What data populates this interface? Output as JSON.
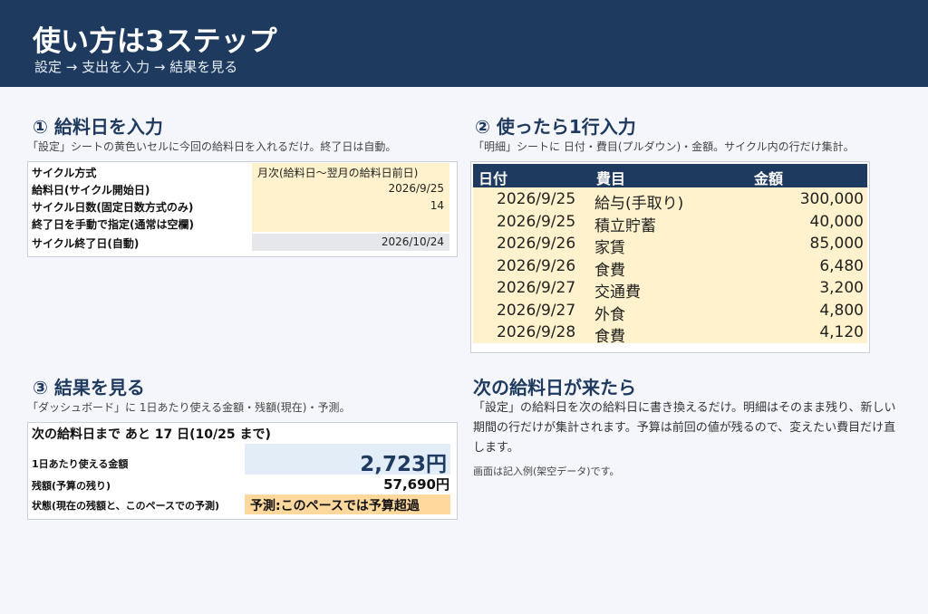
{
  "header": {
    "title": "使い方は3ステップ",
    "subtitle": "設定 → 支出を入力 → 結果を見る"
  },
  "step1": {
    "title": "① 給料日を入力",
    "desc": "「設定」シートの黄色いセルに今回の給料日を入れるだけ。終了日は自動。",
    "rows": [
      {
        "label": "サイクル方式",
        "value": "月次(給料日～翌月の給料日前日)"
      },
      {
        "label": "給料日(サイクル開始日)",
        "value": "2026/9/25"
      },
      {
        "label": "サイクル日数(固定日数方式のみ)",
        "value": "14"
      },
      {
        "label": "終了日を手動で指定(通常は空欄)",
        "value": ""
      },
      {
        "label": "サイクル終了日(自動)",
        "value": "2026/10/24"
      }
    ]
  },
  "step2": {
    "title": "② 使ったら1行入力",
    "desc": "「明細」シートに 日付・費目(プルダウン)・金額。サイクル内の行だけ集計。",
    "headers": {
      "date": "日付",
      "category": "費目",
      "amount": "金額"
    },
    "rows": [
      {
        "date": "2026/9/25",
        "category": "給与(手取り)",
        "amount": "300,000"
      },
      {
        "date": "2026/9/25",
        "category": "積立貯蓄",
        "amount": "40,000"
      },
      {
        "date": "2026/9/26",
        "category": "家賃",
        "amount": "85,000"
      },
      {
        "date": "2026/9/26",
        "category": "食費",
        "amount": "6,480"
      },
      {
        "date": "2026/9/27",
        "category": "交通費",
        "amount": "3,200"
      },
      {
        "date": "2026/9/27",
        "category": "外食",
        "amount": "4,800"
      },
      {
        "date": "2026/9/28",
        "category": "食費",
        "amount": "4,120"
      }
    ]
  },
  "step3": {
    "title": "③ 結果を見る",
    "desc": "「ダッシュボード」に 1日あたり使える金額・残額(現在)・予測。",
    "countdown": "次の給料日まで あと 17 日(10/25 まで)",
    "daily_label": "1日あたり使える金額",
    "daily_value": "2,723円",
    "remaining_label": "残額(予算の残り)",
    "remaining_value": "57,690円",
    "status_label": "状態(現在の残額と、このペースでの予測)",
    "status_value": "予測:このペースでは予算超過"
  },
  "next": {
    "title": "次の給料日が来たら",
    "desc": "「設定」の給料日を次の給料日に書き換えるだけ。明細はそのまま残り、新しい期間の行だけが集計されます。予算は前回の値が残るので、変えたい費目だけ直します。",
    "note": "画面は記入例(架空データ)です。"
  },
  "colors": {
    "header_bg": "#1f3a5f",
    "input_cell": "#fff2cc",
    "highlight": "#ffd89e",
    "daily_bg": "#e3edf8"
  }
}
